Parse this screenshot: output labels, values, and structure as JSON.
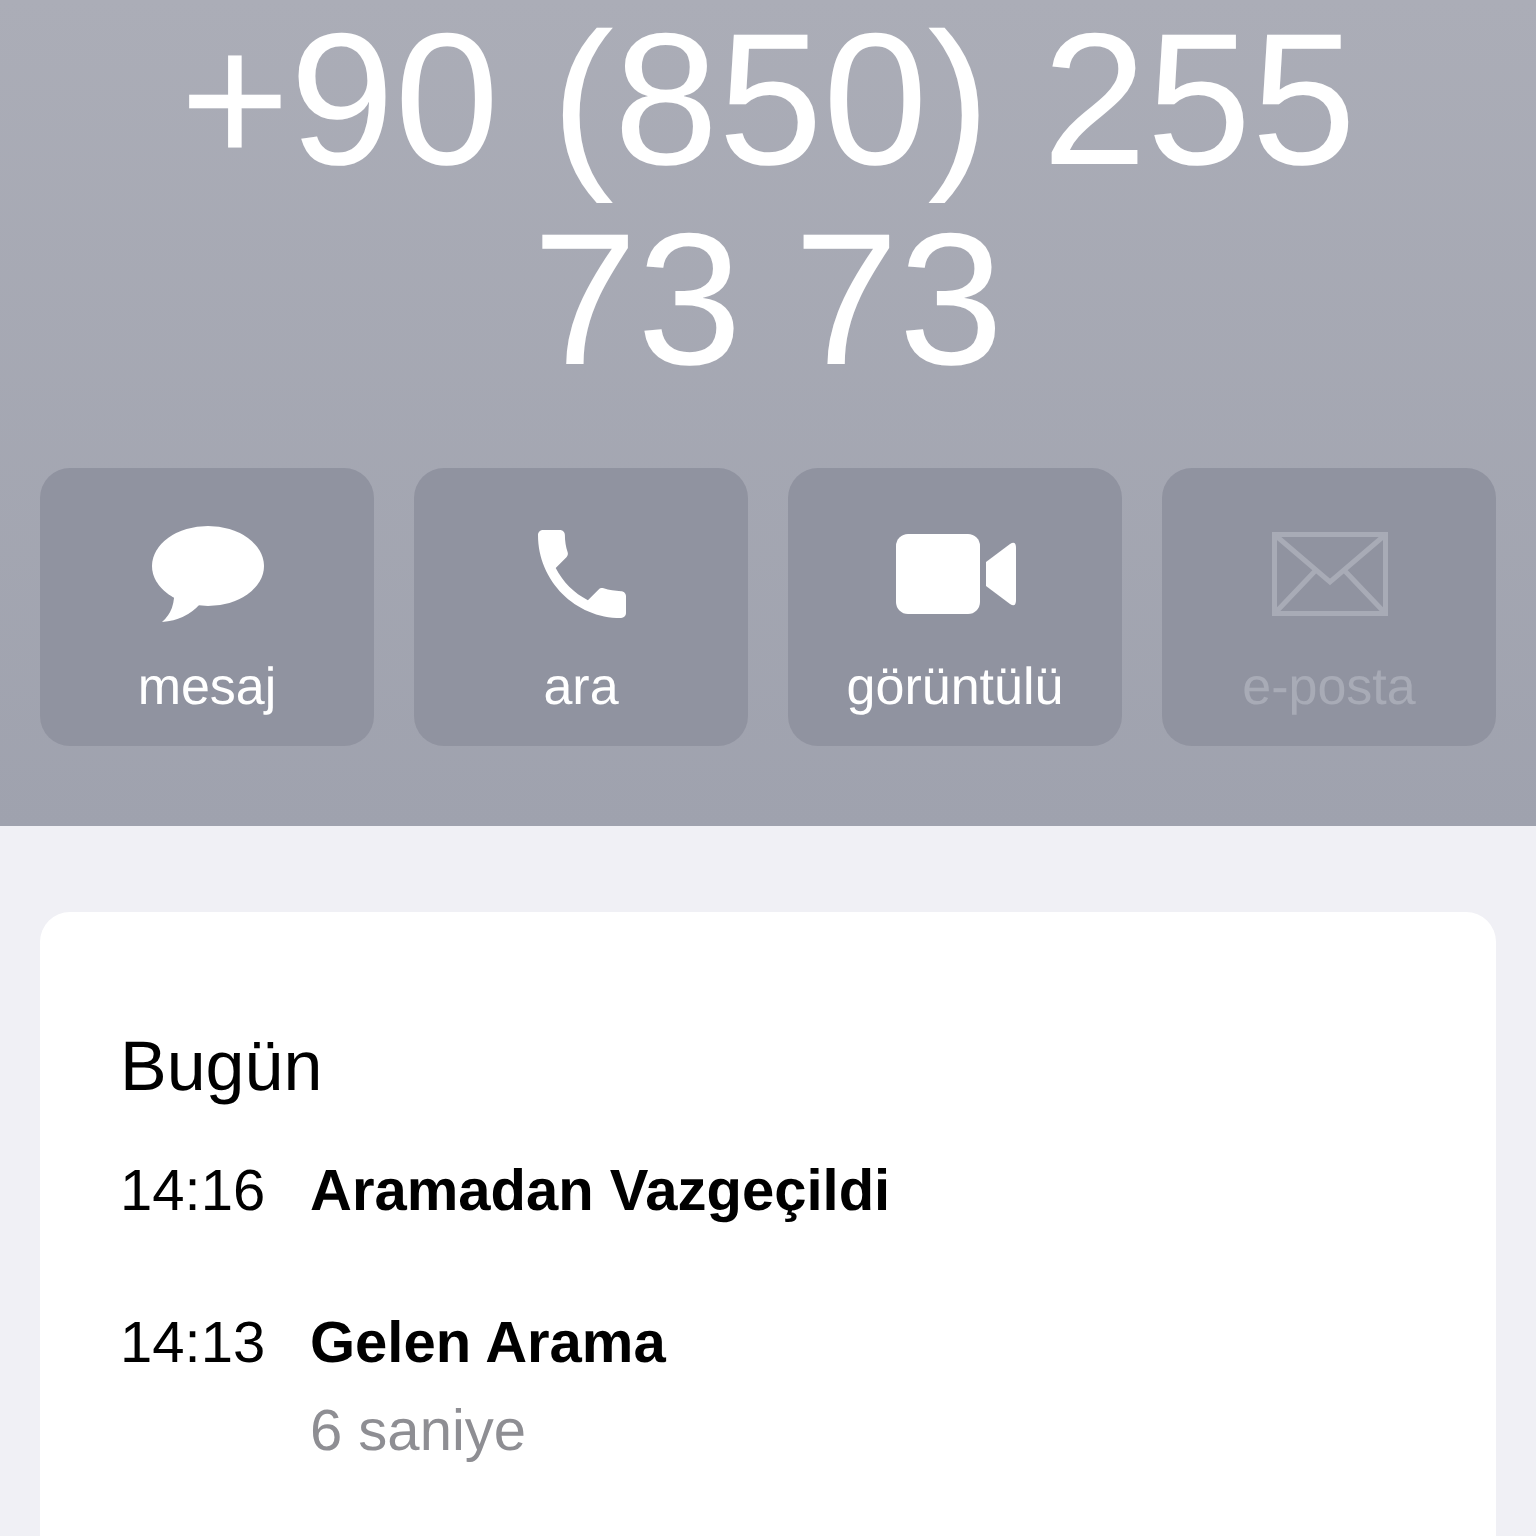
{
  "contact": {
    "phone_number": "+90 (850) 255 73 73"
  },
  "actions": [
    {
      "kind": "message",
      "label": "mesaj",
      "disabled": false
    },
    {
      "kind": "call",
      "label": "ara",
      "disabled": false
    },
    {
      "kind": "video",
      "label": "görüntülü",
      "disabled": false
    },
    {
      "kind": "mail",
      "label": "e-posta",
      "disabled": true
    }
  ],
  "call_history": {
    "heading": "Bugün",
    "entries": [
      {
        "time": "14:16",
        "title": "Aramadan Vazgeçildi"
      },
      {
        "time": "14:13",
        "title": "Gelen Arama",
        "duration": "6 saniye"
      }
    ]
  }
}
